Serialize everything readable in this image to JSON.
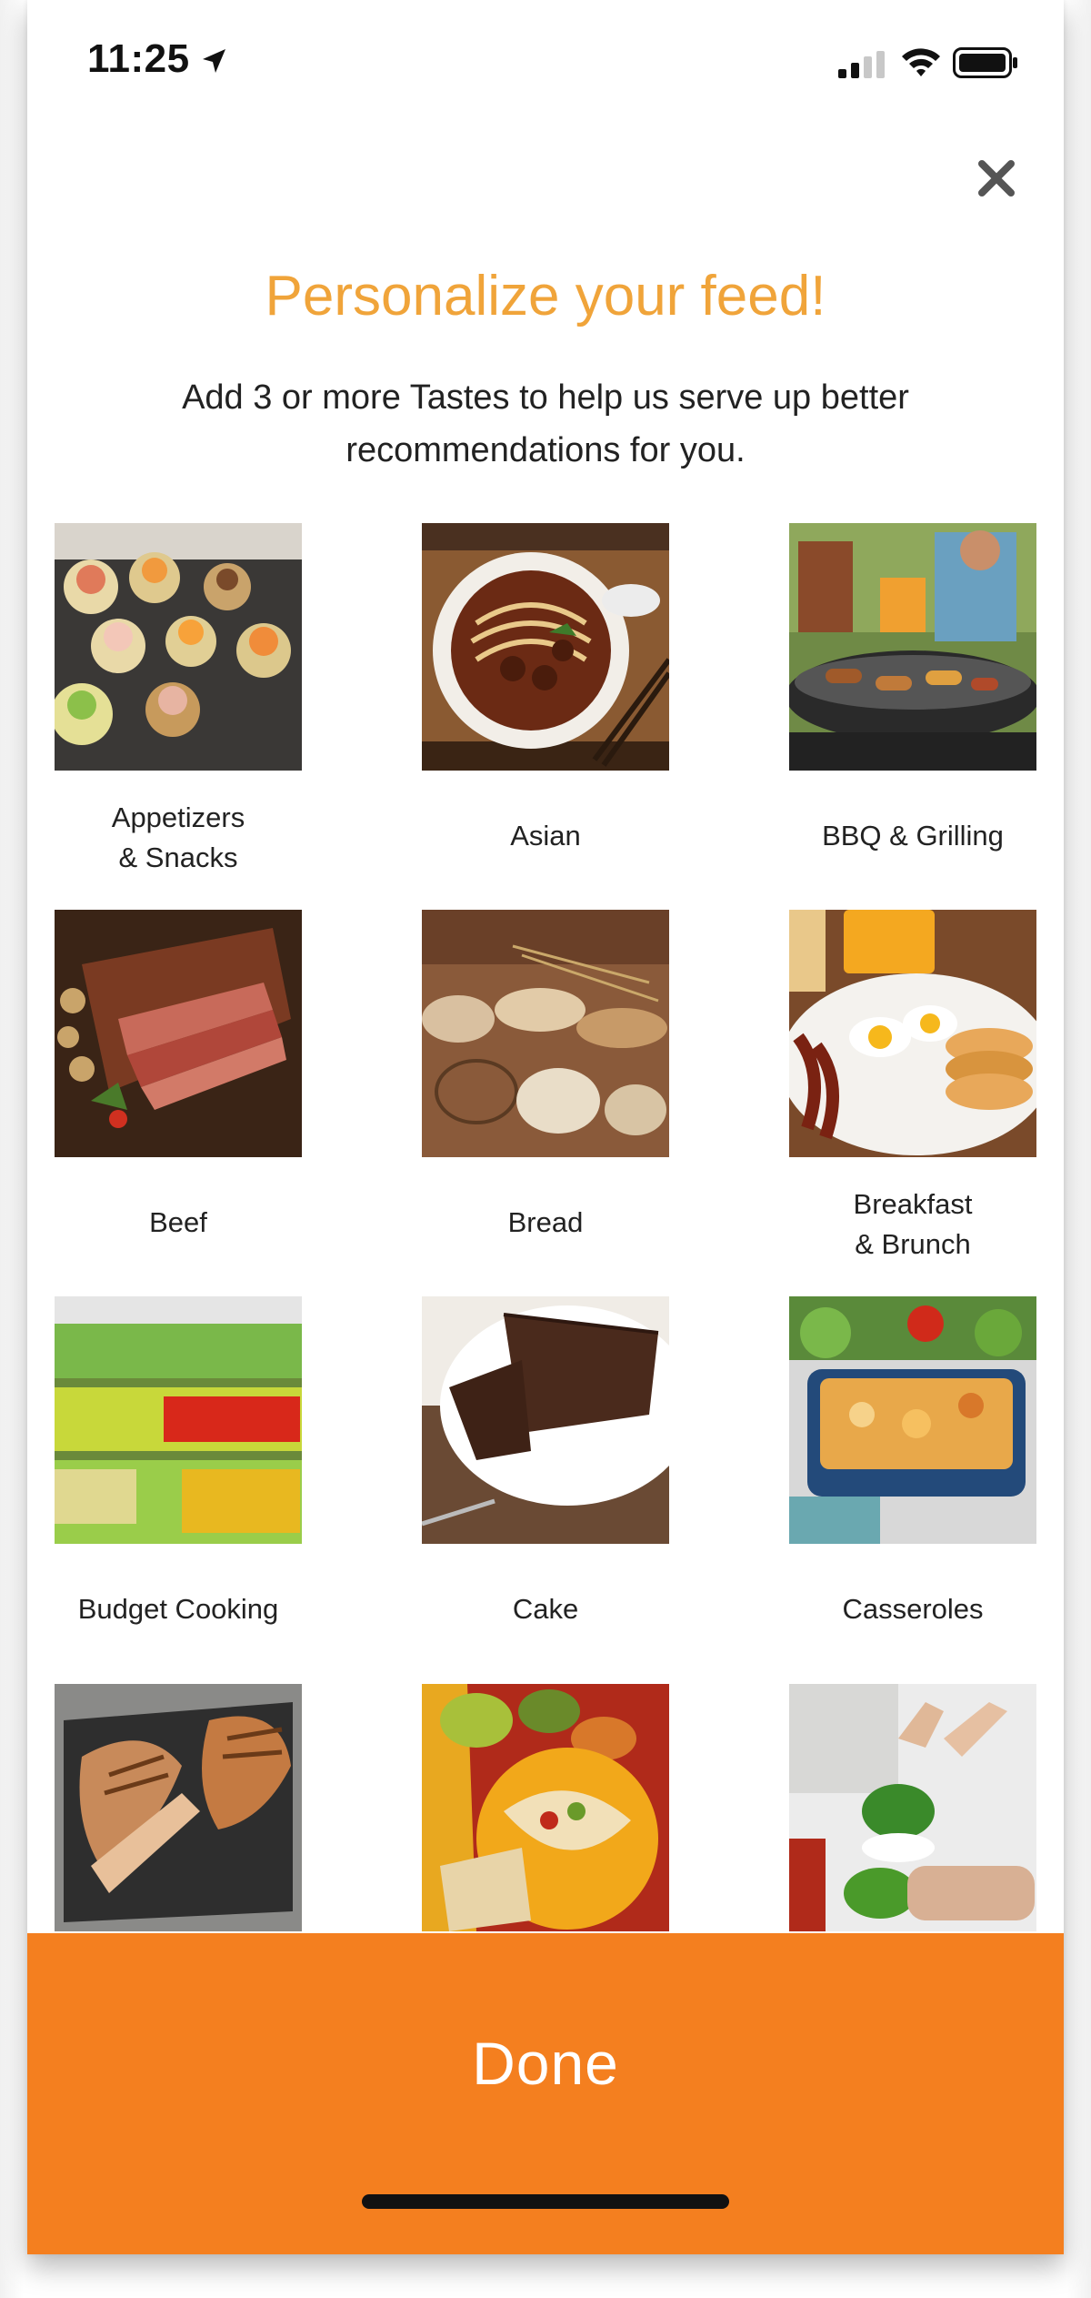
{
  "status_bar": {
    "time": "11:25",
    "icons": [
      "location-arrow-icon",
      "cellular-signal-icon",
      "wifi-icon",
      "battery-icon"
    ]
  },
  "header": {
    "close_icon": "close-icon",
    "title": "Personalize your feed!",
    "subtitle": "Add 3 or more Tastes to help us serve up better recommendations for you."
  },
  "tastes": [
    {
      "label": "Appetizers\n& Snacks"
    },
    {
      "label": "Asian"
    },
    {
      "label": "BBQ & Grilling"
    },
    {
      "label": "Beef"
    },
    {
      "label": "Bread"
    },
    {
      "label": "Breakfast\n& Brunch"
    },
    {
      "label": "Budget Cooking"
    },
    {
      "label": "Cake"
    },
    {
      "label": "Casseroles"
    },
    {
      "label": ""
    },
    {
      "label": ""
    },
    {
      "label": ""
    }
  ],
  "footer": {
    "done_label": "Done"
  },
  "colors": {
    "title": "#f0a43a",
    "done_bar": "#f47f1f",
    "done_text": "#ffffff"
  }
}
